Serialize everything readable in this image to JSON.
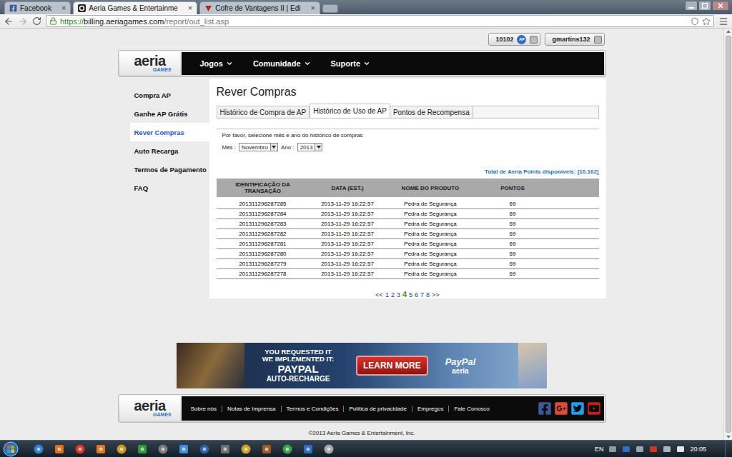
{
  "browser": {
    "tabs": [
      {
        "label": "Facebook",
        "selected": false,
        "close": "×"
      },
      {
        "label": "Aeria Games & Entertainme",
        "selected": true,
        "close": "×"
      },
      {
        "label": "Cofre de Vantagens II | Edi",
        "selected": false,
        "close": "×"
      }
    ],
    "url": {
      "scheme": "https://",
      "host": "billing.aeriagames.com",
      "path": "/report/out_list.asp"
    }
  },
  "account": {
    "points": "10102",
    "points_badge": "AP",
    "username": "gmartins132"
  },
  "logo": {
    "word": "aeria",
    "sub": "GAMES"
  },
  "nav": [
    {
      "label": "Jogos"
    },
    {
      "label": "Comunidade"
    },
    {
      "label": "Suporte"
    }
  ],
  "sidebar": {
    "items": [
      {
        "label": "Compra AP",
        "selected": false
      },
      {
        "label": "Ganhe AP Grátis",
        "selected": false
      },
      {
        "label": "Rever Compras",
        "selected": true
      },
      {
        "label": "Auto Recarga",
        "selected": false
      },
      {
        "label": "Termos de Pagamento",
        "selected": false
      },
      {
        "label": "FAQ",
        "selected": false
      }
    ]
  },
  "page": {
    "title": "Rever Compras",
    "tabs": [
      {
        "label": "Histórico de Compra de AP",
        "selected": false
      },
      {
        "label": "Histórico de Uso de AP",
        "selected": true
      },
      {
        "label": "Pontos de Recompensa",
        "selected": false
      }
    ],
    "instruction": "Por favor, selecione mês e ano do histórico de compras",
    "month": {
      "label": "Mês :",
      "value": "Novembro"
    },
    "year": {
      "label": "Ano :",
      "value": "2013"
    },
    "total": {
      "label": "Total de Aeria Points disponíveis:",
      "value": "[10.102]"
    }
  },
  "table": {
    "columns": [
      "IDENTIFICAÇÃO DA TRANSAÇÃO",
      "DATA (EST.)",
      "NOME DO PRODUTO",
      "PONTOS"
    ],
    "rows": [
      [
        "201311296287285",
        "2013-11-29 16:22:57",
        "Pedra de Segurança",
        "69"
      ],
      [
        "201311296287284",
        "2013-11-29 16:22:57",
        "Pedra de Segurança",
        "69"
      ],
      [
        "201311296287283",
        "2013-11-29 16:22:57",
        "Pedra de Segurança",
        "69"
      ],
      [
        "201311296287282",
        "2013-11-29 16:22:57",
        "Pedra de Segurança",
        "69"
      ],
      [
        "201311296287281",
        "2013-11-29 16:22:57",
        "Pedra de Segurança",
        "69"
      ],
      [
        "201311296287280",
        "2013-11-29 16:22:57",
        "Pedra de Segurança",
        "69"
      ],
      [
        "201311296287279",
        "2013-11-29 16:22:57",
        "Pedra de Segurança",
        "69"
      ],
      [
        "201311296287278",
        "2013-11-29 16:22:57",
        "Pedra de Segurança",
        "69"
      ]
    ]
  },
  "pagination": {
    "prev": "<<",
    "next": ">>",
    "pages": [
      {
        "label": "1",
        "selected": false
      },
      {
        "label": "2",
        "selected": false
      },
      {
        "label": "3",
        "selected": false
      },
      {
        "label": "4",
        "selected": true
      },
      {
        "label": "5",
        "selected": false
      },
      {
        "label": "6",
        "selected": false
      },
      {
        "label": "7",
        "selected": false
      },
      {
        "label": "8",
        "selected": false
      }
    ]
  },
  "banner": {
    "lines": [
      "YOU REQUESTED IT",
      "WE IMPLEMENTED IT:"
    ],
    "headline": "PAYPAL",
    "subline": "AUTO-RECHARGE",
    "button": "LEARN MORE",
    "brand": "PayPal",
    "brand_sub": "aeria"
  },
  "footer": {
    "links": [
      "Sobre nós",
      "Notas de Imprensa",
      "Termos e Condições",
      "Política de privacidade",
      "Empregos",
      "Fale Conosco"
    ],
    "copyright": "©2013 Aeria Games & Entertainment, Inc."
  },
  "taskbar": {
    "language": "EN",
    "time": "20:05"
  }
}
